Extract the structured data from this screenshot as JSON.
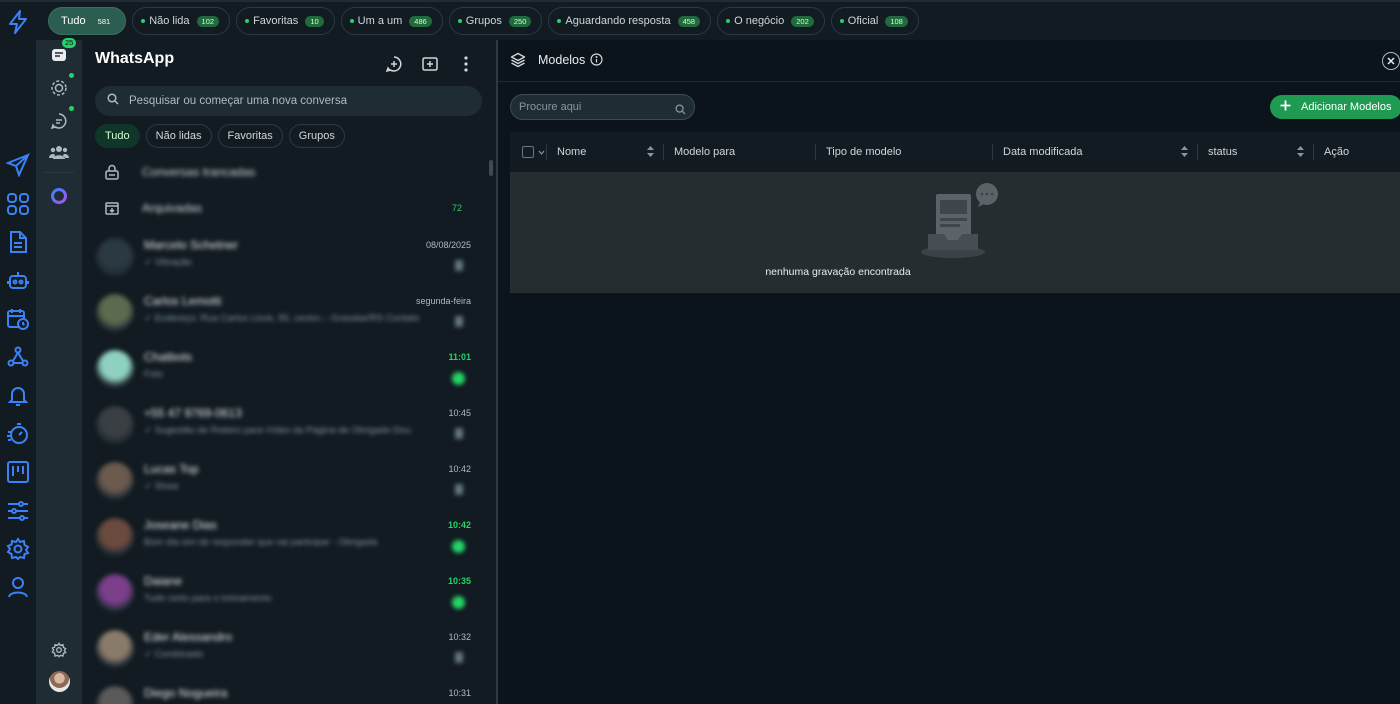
{
  "top_filters": [
    {
      "label": "Tudo",
      "count": "581",
      "active": true
    },
    {
      "label": "Não lida",
      "count": "102"
    },
    {
      "label": "Favoritas",
      "count": "10"
    },
    {
      "label": "Um a um",
      "count": "486"
    },
    {
      "label": "Grupos",
      "count": "250"
    },
    {
      "label": "Aguardando resposta",
      "count": "458"
    },
    {
      "label": "O negócio",
      "count": "202"
    },
    {
      "label": "Oficial",
      "count": "108"
    }
  ],
  "nav": {
    "chat_badge": "25"
  },
  "chat_panel": {
    "title": "WhatsApp",
    "search_placeholder": "Pesquisar ou começar uma nova conversa",
    "filters": [
      {
        "label": "Tudo",
        "active": true
      },
      {
        "label": "Não lidas"
      },
      {
        "label": "Favoritas"
      },
      {
        "label": "Grupos"
      }
    ],
    "locked_label": "Conversas trancadas",
    "archived_label": "Arquivadas",
    "archived_count": "72",
    "chats": [
      {
        "name": "Marcelo Schetner",
        "preview": "✓ Vibração",
        "time": "08/08/2025",
        "unread": false
      },
      {
        "name": "Carlos Lemotti",
        "preview": "✓ Endereço: Rua Carlos Linck, 95, centro – Gravataí/RS Contato",
        "time": "segunda-feira",
        "unread": false
      },
      {
        "name": "Chatbots",
        "preview": "Foto",
        "time": "11:01",
        "unread": true
      },
      {
        "name": "+55 47 9769-0613",
        "preview": "✓ Sugestão de Roteiro para Vídeo da Página de Obrigado Dou",
        "time": "10:45",
        "unread": false
      },
      {
        "name": "Lucas Top",
        "preview": "✓ Show",
        "time": "10:42",
        "unread": false
      },
      {
        "name": "Joseane Dias",
        "preview": "Bom dia sim de responder que vai participar - Obrigada",
        "time": "10:42",
        "unread": true
      },
      {
        "name": "Daiane",
        "preview": "Tudo certo para o treinamento",
        "time": "10:35",
        "unread": true
      },
      {
        "name": "Eder Alessandro",
        "preview": "✓ Combinado",
        "time": "10:32",
        "unread": false
      },
      {
        "name": "Diego Nogueira",
        "preview": "",
        "time": "10:31",
        "unread": false
      }
    ]
  },
  "models": {
    "title": "Modelos",
    "search_placeholder": "Procure aqui",
    "add_button": "Adicionar Modelos",
    "columns": [
      "Nome",
      "Modelo para",
      "Tipo de modelo",
      "Data modificada",
      "status",
      "Ação"
    ],
    "empty_message": "nenhuma gravação encontrada"
  },
  "colors": {
    "accent": "#25d366",
    "primary_button": "#1f9a52",
    "rail_icon": "#3b82f6"
  },
  "icons": [
    "lightning-logo-icon",
    "chat-icon",
    "status-icon",
    "channels-icon",
    "communities-icon",
    "send-icon",
    "apps-grid-icon",
    "document-icon",
    "robot-icon",
    "calendar-clock-icon",
    "webhook-icon",
    "bell-icon",
    "timer-icon",
    "kanban-icon",
    "sliders-icon",
    "gear-icon",
    "user-icon",
    "meta-ai-icon",
    "new-chat-icon",
    "add-icon",
    "more-icon",
    "search-icon",
    "layers-icon",
    "info-icon",
    "close-icon",
    "plus-icon",
    "empty-inbox-icon"
  ]
}
